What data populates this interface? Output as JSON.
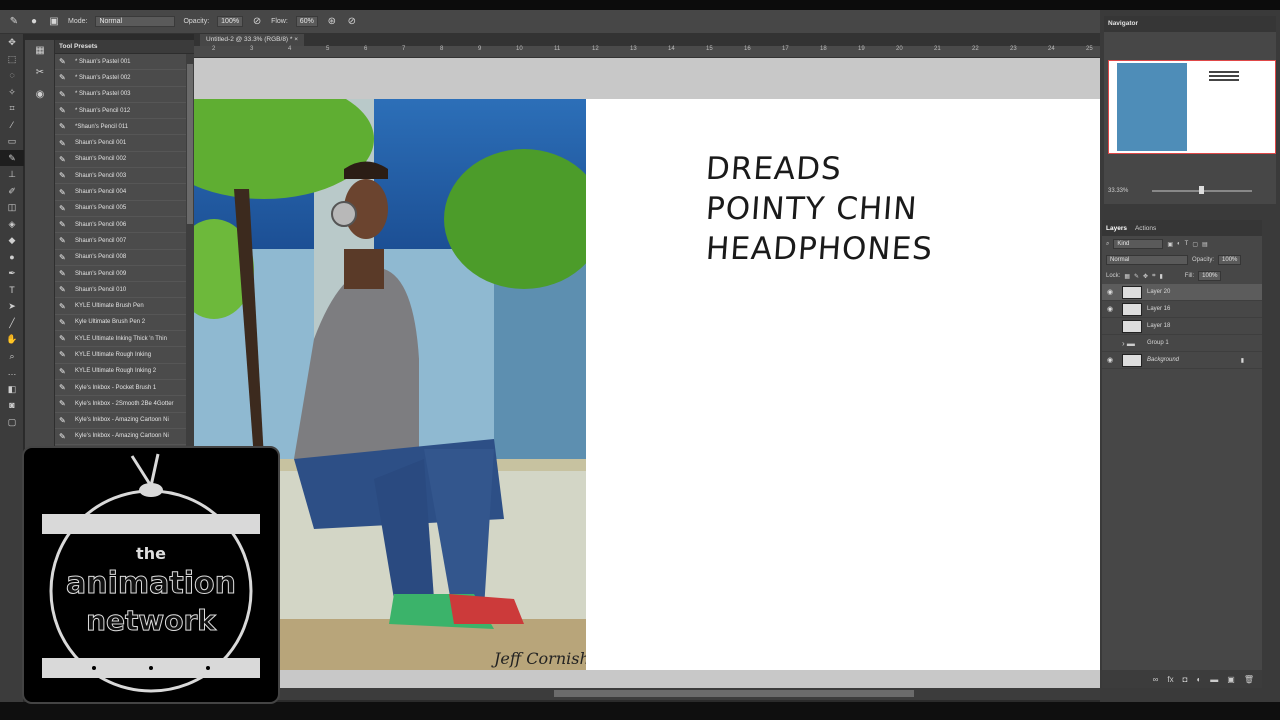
{
  "options_bar": {
    "mode_label": "Mode:",
    "mode_value": "Normal",
    "opacity_label": "Opacity:",
    "opacity_value": "100%",
    "flow_label": "Flow:",
    "flow_value": "60%"
  },
  "document": {
    "tab_title": "Untitled-2 @ 33.3% (RGB/8) *",
    "ruler_ticks": [
      "2",
      "3",
      "4",
      "5",
      "6",
      "7",
      "8",
      "9",
      "10",
      "11",
      "12",
      "13",
      "14",
      "15",
      "16",
      "17",
      "18",
      "19",
      "20",
      "21",
      "22",
      "23",
      "24",
      "25"
    ]
  },
  "tool_presets": {
    "title": "Tool Presets",
    "items": [
      "* Shaun's Pastel 001",
      "* Shaun's Pastel 002",
      "* Shaun's Pastel 003",
      "* Shaun's Pencil 012",
      "*Shaun's Pencil 011",
      "Shaun's Pencil 001",
      "Shaun's Pencil 002",
      "Shaun's Pencil 003",
      "Shaun's Pencil 004",
      "Shaun's Pencil 005",
      "Shaun's Pencil 006",
      "Shaun's Pencil 007",
      "Shaun's Pencil 008",
      "Shaun's Pencil 009",
      "Shaun's Pencil 010",
      "KYLE Ultimate Brush Pen",
      "Kyle Ultimate Brush Pen 2",
      "KYLE Ultimate Inking Thick 'n Thin",
      "KYLE Ultimate Rough Inking",
      "KYLE Ultimate Rough Inking 2",
      "Kyle's Inkbox - Pocket Brush 1",
      "Kyle's Inkbox - 2Smooth 2Be 4Gotter",
      "Kyle's Inkbox - Amazing Cartoon Ni",
      "Kyle's Inkbox - Amazing Cartoon Ni"
    ]
  },
  "canvas": {
    "notes": [
      "DREADS",
      "POINTY CHIN",
      "HEADPHONES"
    ],
    "signature": "Jeff Cornish"
  },
  "navigator": {
    "title": "Navigator",
    "zoom": "33.33%"
  },
  "layers_panel": {
    "tab_layers": "Layers",
    "tab_actions": "Actions",
    "filter_kind": "Kind",
    "blend_mode": "Normal",
    "opacity_label": "Opacity:",
    "opacity_value": "100%",
    "lock_label": "Lock:",
    "fill_label": "Fill:",
    "fill_value": "100%",
    "layers": [
      {
        "name": "Layer 20",
        "visible": true,
        "selected": true
      },
      {
        "name": "Layer 16",
        "visible": true,
        "selected": false
      },
      {
        "name": "Layer 18",
        "visible": false,
        "selected": false
      },
      {
        "name": "Group 1",
        "visible": false,
        "selected": false
      },
      {
        "name": "Background",
        "visible": true,
        "selected": false
      }
    ]
  },
  "watermark": {
    "line1": "the",
    "line2": "animation",
    "line3": "network"
  },
  "colors": {
    "panel": "#474747",
    "canvas_bg": "#c8c8c8",
    "selection_red": "#e04848"
  }
}
